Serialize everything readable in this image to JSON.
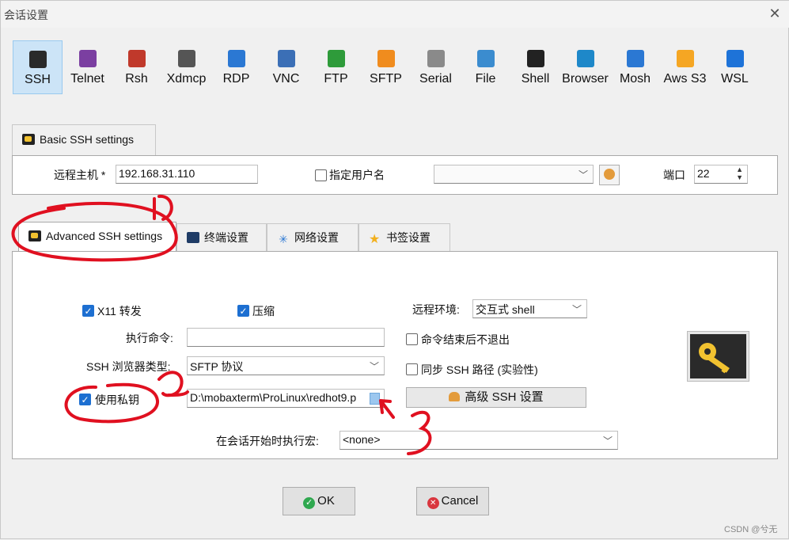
{
  "window": {
    "title": "会话设置"
  },
  "protocols": [
    {
      "label": "SSH",
      "color": "#2a2a2a"
    },
    {
      "label": "Telnet",
      "color": "#7b3fa1"
    },
    {
      "label": "Rsh",
      "color": "#c0392b"
    },
    {
      "label": "Xdmcp",
      "color": "#555555"
    },
    {
      "label": "RDP",
      "color": "#2b78d3"
    },
    {
      "label": "VNC",
      "color": "#3b6fb6"
    },
    {
      "label": "FTP",
      "color": "#2e9b3a"
    },
    {
      "label": "SFTP",
      "color": "#f08c1e"
    },
    {
      "label": "Serial",
      "color": "#8a8a8a"
    },
    {
      "label": "File",
      "color": "#3b8ccf"
    },
    {
      "label": "Shell",
      "color": "#222222"
    },
    {
      "label": "Browser",
      "color": "#1e88c9"
    },
    {
      "label": "Mosh",
      "color": "#2b78d3"
    },
    {
      "label": "Aws S3",
      "color": "#f5a623"
    },
    {
      "label": "WSL",
      "color": "#1e73d8"
    }
  ],
  "basic": {
    "tab_label": "Basic SSH settings",
    "host_label": "远程主机 *",
    "host_value": "192.168.31.110",
    "user_check_label": "指定用户名",
    "port_label": "端口",
    "port_value": "22"
  },
  "tabs": [
    {
      "label": "Advanced SSH settings"
    },
    {
      "label": "终端设置"
    },
    {
      "label": "网络设置"
    },
    {
      "label": "书签设置"
    }
  ],
  "advanced": {
    "x11_label": "X11 转发",
    "compress_label": "压缩",
    "remote_env_label": "远程环境:",
    "remote_env_value": "交互式 shell",
    "exec_cmd_label": "执行命令:",
    "exec_cmd_value": "",
    "no_exit_label": "命令结束后不退出",
    "browser_type_label": "SSH 浏览器类型:",
    "browser_type_value": "SFTP 协议",
    "sync_path_label": "同步 SSH 路径 (实验性)",
    "use_key_label": "使用私钥",
    "key_path_value": "D:\\mobaxterm\\ProLinux\\redhot9.p",
    "adv_button_label": "高级 SSH 设置",
    "macro_label": "在会话开始时执行宏:",
    "macro_value": "<none>"
  },
  "buttons": {
    "ok": "OK",
    "cancel": "Cancel"
  },
  "annotations": {
    "n1": "1",
    "n2": "2",
    "n3": "3"
  },
  "watermark": "CSDN @兮无"
}
